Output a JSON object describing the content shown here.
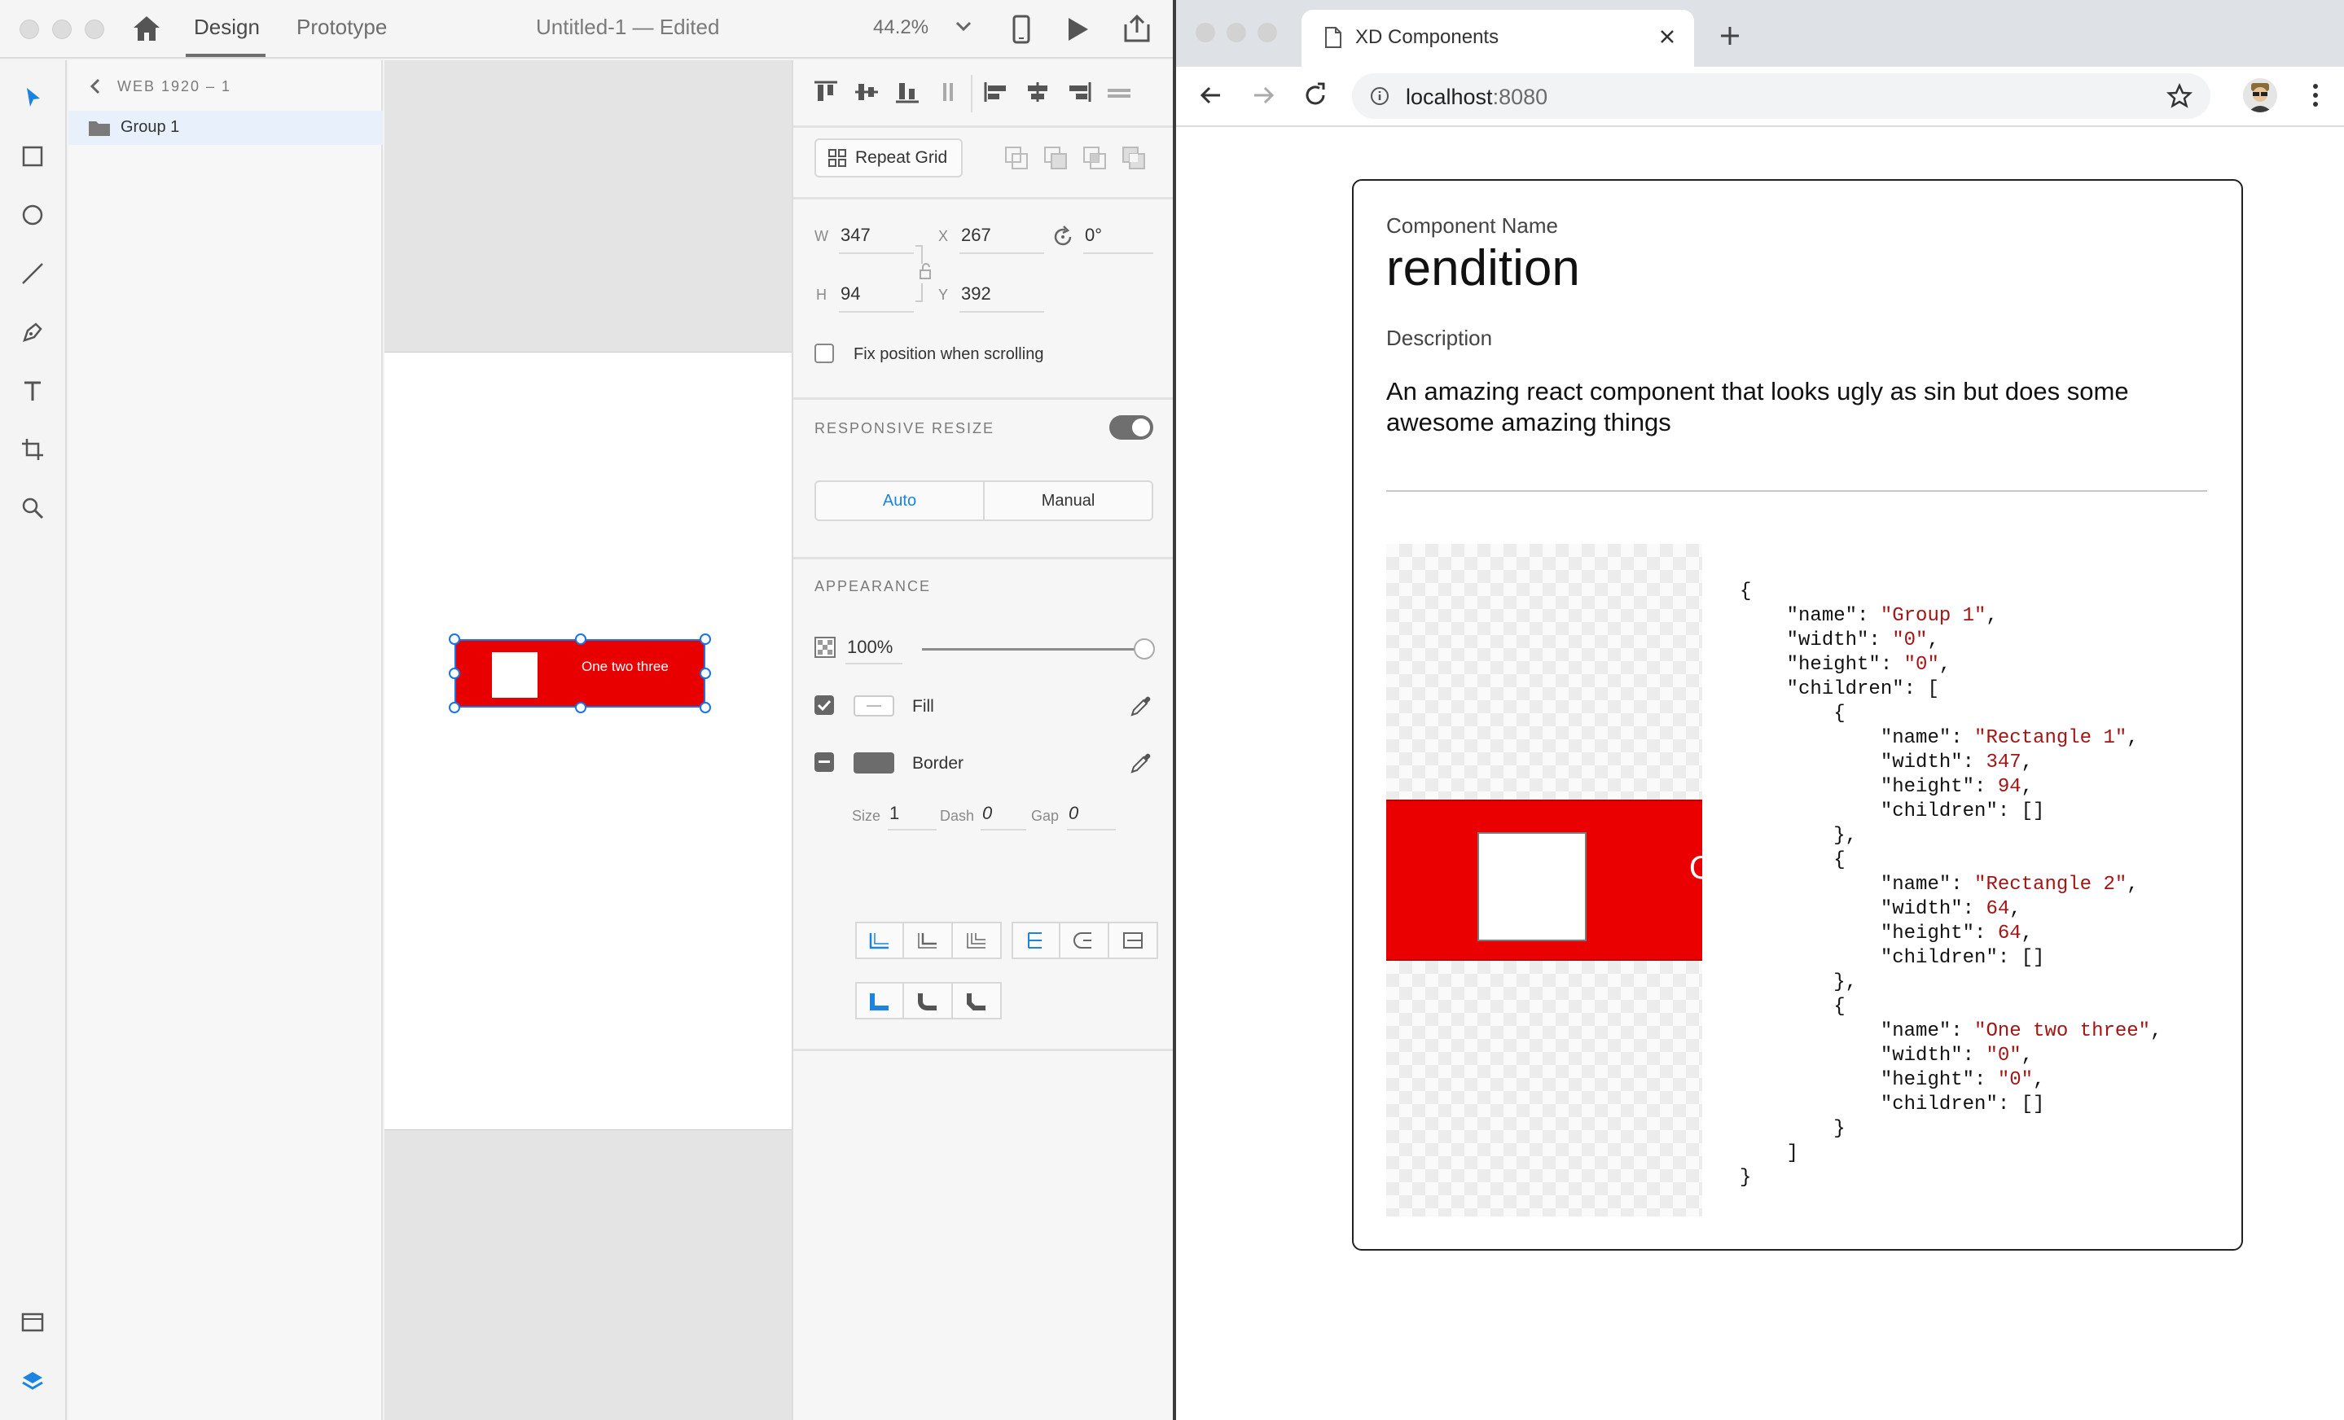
{
  "xd": {
    "tabs": {
      "design": "Design",
      "prototype": "Prototype"
    },
    "doc_title": "Untitled-1  —  Edited",
    "zoom": "44.2%",
    "layers": {
      "crumb": "WEB 1920 – 1",
      "group": "Group 1"
    },
    "artboard_text": "One two three",
    "props": {
      "repeat_grid": "Repeat Grid",
      "w_label": "W",
      "w": "347",
      "x_label": "X",
      "x": "267",
      "rotation": "0°",
      "h_label": "H",
      "h": "94",
      "y_label": "Y",
      "y": "392",
      "fix_position": "Fix position when scrolling",
      "responsive_resize": "RESPONSIVE RESIZE",
      "auto": "Auto",
      "manual": "Manual",
      "appearance": "APPEARANCE",
      "opacity": "100%",
      "fill": "Fill",
      "border": "Border",
      "size_label": "Size",
      "size": "1",
      "dash_label": "Dash",
      "dash": "0",
      "gap_label": "Gap",
      "gap": "0"
    }
  },
  "browser": {
    "tab_title": "XD Components",
    "url_host": "localhost",
    "url_port": ":8080"
  },
  "card": {
    "name_label": "Component Name",
    "name": "rendition",
    "desc_label": "Description",
    "desc": "An amazing react component that looks ugly as sin but does some awesome amazing things",
    "preview_text": "One two three",
    "json_lines": [
      [
        "{"
      ],
      [
        "    \"name\": ",
        "\"Group 1\"",
        ","
      ],
      [
        "    \"width\": ",
        "\"0\"",
        ","
      ],
      [
        "    \"height\": ",
        "\"0\"",
        ","
      ],
      [
        "    \"children\": ["
      ],
      [
        "        {"
      ],
      [
        "            \"name\": ",
        "\"Rectangle 1\"",
        ","
      ],
      [
        "            \"width\": ",
        "347",
        ","
      ],
      [
        "            \"height\": ",
        "94",
        ","
      ],
      [
        "            \"children\": []"
      ],
      [
        "        },"
      ],
      [
        "        {"
      ],
      [
        "            \"name\": ",
        "\"Rectangle 2\"",
        ","
      ],
      [
        "            \"width\": ",
        "64",
        ","
      ],
      [
        "            \"height\": ",
        "64",
        ","
      ],
      [
        "            \"children\": []"
      ],
      [
        "        },"
      ],
      [
        "        {"
      ],
      [
        "            \"name\": ",
        "\"One two three\"",
        ","
      ],
      [
        "            \"width\": ",
        "\"0\"",
        ","
      ],
      [
        "            \"height\": ",
        "\"0\"",
        ","
      ],
      [
        "            \"children\": []"
      ],
      [
        "        }"
      ],
      [
        "    ]"
      ],
      [
        "}"
      ]
    ]
  },
  "colors": {
    "accent": "#1a84e0",
    "red": "#ea0000",
    "selection": "#1a73e8"
  }
}
